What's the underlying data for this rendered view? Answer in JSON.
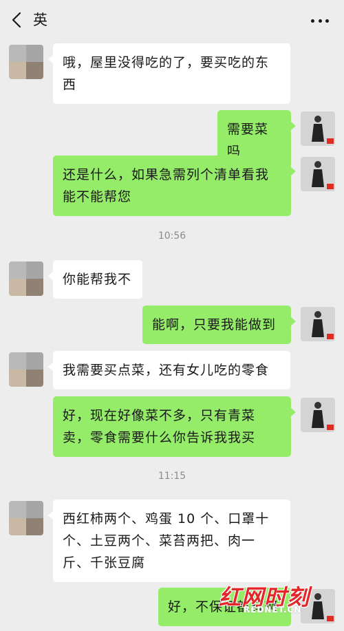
{
  "header": {
    "title": "英"
  },
  "messages": [
    {
      "side": "left",
      "text": "哦，屋里没得吃的了，要买吃的东西"
    },
    {
      "side": "right",
      "text": "需要菜吗"
    },
    {
      "side": "right",
      "text": "还是什么，如果急需列个清单看我能不能帮您"
    },
    {
      "side": "left",
      "text": "你能帮我不"
    },
    {
      "side": "right",
      "text": "能啊，只要我能做到"
    },
    {
      "side": "left",
      "text": "我需要买点菜，还有女儿吃的零食"
    },
    {
      "side": "right",
      "text": "好，现在好像菜不多，只有青菜卖，零食需要什么你告诉我我买"
    },
    {
      "side": "left",
      "text": "西红柿两个、鸡蛋 10 个、口罩十个、土豆两个、菜苔两把、肉一斤、千张豆腐"
    },
    {
      "side": "right",
      "text": "好，不保证都有啊"
    }
  ],
  "timestamps": [
    "10:56",
    "11:15"
  ],
  "watermark": {
    "main": "红网时刻",
    "sub": "REDNET.CN"
  },
  "colors": {
    "background": "#ededed",
    "bubble_self": "#95ec69",
    "bubble_other": "#ffffff",
    "watermark": "#e3262a"
  },
  "icons": {
    "back": "chevron-left-icon",
    "more": "more-dots-icon"
  }
}
